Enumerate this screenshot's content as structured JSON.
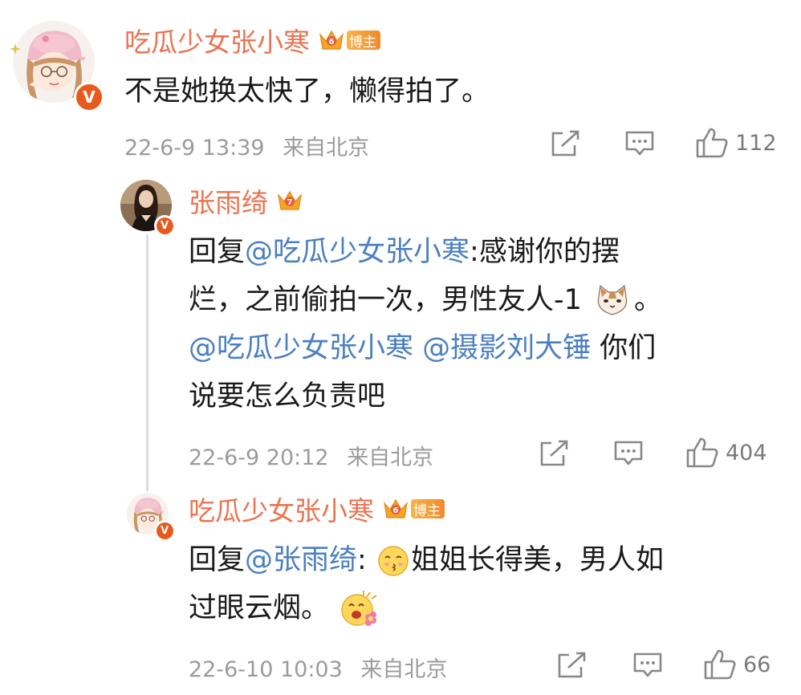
{
  "colors": {
    "username": "#eb7350",
    "mention": "#4a7fc1",
    "meta": "#9b9b9b",
    "text": "#1a1a1a",
    "verified_badge": "#e85a1c"
  },
  "comments": [
    {
      "username": "吃瓜少女张小寒",
      "badge_icon": "crown-level-6-icon",
      "role_tag": "博主",
      "text": "不是她换太快了，懒得拍了。",
      "time": "22-6-9 13:39",
      "location": "来自北京",
      "likes": "112"
    },
    {
      "username": "张雨绮",
      "badge_icon": "crown-icon",
      "reply_prefix": "回复",
      "reply_to": "@吃瓜少女张小寒",
      "line1_rest": ":感谢你的摆",
      "line2": "烂，之前偷拍一次，男性友人-1",
      "line2_end": "。",
      "line3_mention1": "@吃瓜少女张小寒",
      "line3_mention2": "@摄影刘大锤",
      "line3_rest": " 你们",
      "line4": "说要怎么负责吧",
      "time": "22-6-9 20:12",
      "location": "来自北京",
      "likes": "404"
    },
    {
      "username": "吃瓜少女张小寒",
      "badge_icon": "crown-level-6-icon",
      "role_tag": "博主",
      "reply_prefix": "回复",
      "reply_to": "@张雨绮",
      "line1_colon": ":",
      "line1_rest": "姐姐长得美，男人如",
      "line2": "过眼云烟。",
      "time": "22-6-10 10:03",
      "location": "来自北京",
      "likes": "66"
    }
  ]
}
